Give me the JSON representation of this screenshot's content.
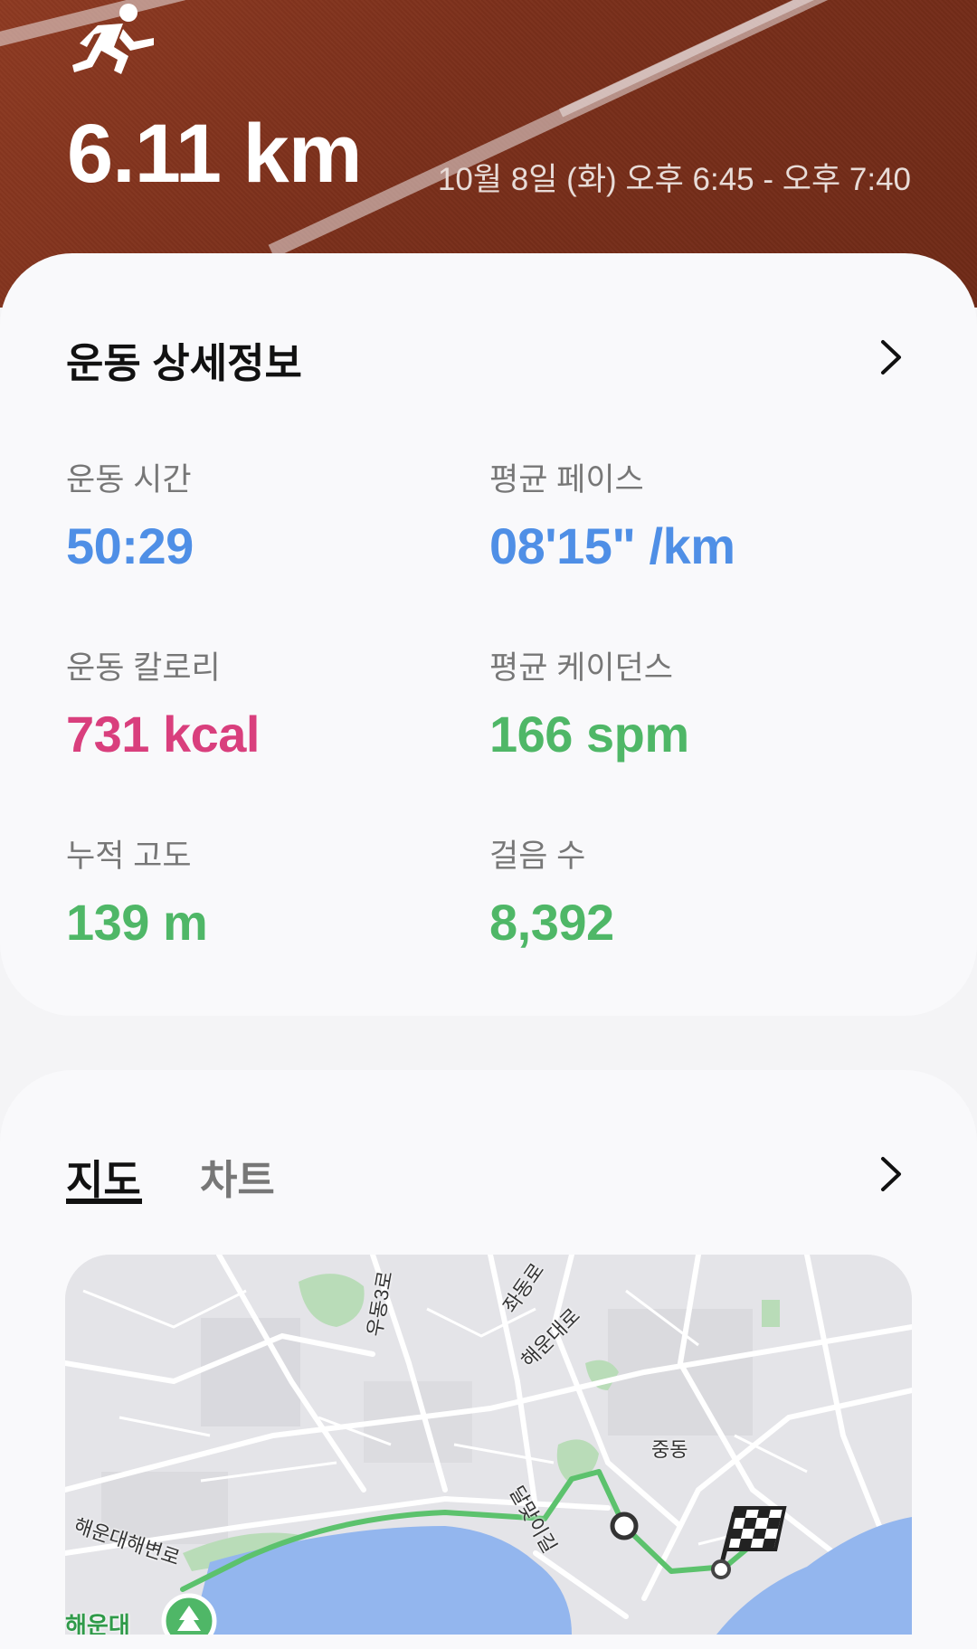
{
  "header": {
    "icon": "running-person-icon",
    "distance": "6.11 km",
    "datetime": "10월 8일 (화) 오후 6:45 - 오후 7:40"
  },
  "details": {
    "title": "운동 상세정보",
    "stats": [
      {
        "label": "운동 시간",
        "value": "50:29",
        "color": "#4f8fe6"
      },
      {
        "label": "평균 페이스",
        "value": "08'15\" /km",
        "color": "#4f8fe6"
      },
      {
        "label": "운동 칼로리",
        "value": "731 kcal",
        "color": "#d93f7d"
      },
      {
        "label": "평균 케이던스",
        "value": "166 spm",
        "color": "#4fb767"
      },
      {
        "label": "누적 고도",
        "value": "139 m",
        "color": "#4fb767"
      },
      {
        "label": "걸음 수",
        "value": "8,392",
        "color": "#4fb767"
      }
    ]
  },
  "map_section": {
    "tabs": [
      {
        "label": "지도",
        "active": true
      },
      {
        "label": "차트",
        "active": false
      }
    ],
    "map_labels": [
      "우동3로",
      "좌동로",
      "해운대로",
      "중동",
      "달맞이길",
      "해운대해변로",
      "해운대"
    ],
    "route_color": "#5cc26d",
    "water_color": "#93b6ee"
  }
}
